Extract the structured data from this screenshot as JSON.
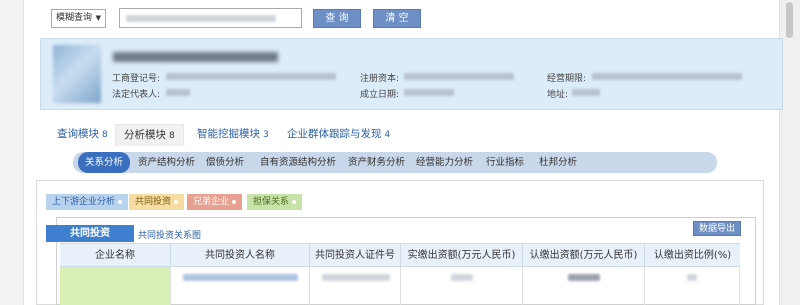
{
  "search": {
    "mode_label": "模糊查询",
    "query_button": "查 询",
    "clear_button": "清 空"
  },
  "company": {
    "fields": [
      {
        "label": "工商登记号:"
      },
      {
        "label": "注册资本:"
      },
      {
        "label": "经营期限:"
      },
      {
        "label": "法定代表人:"
      },
      {
        "label": "成立日期:"
      },
      {
        "label": "地址:"
      }
    ]
  },
  "main_tabs": [
    {
      "label": "查询模块",
      "count": "8"
    },
    {
      "label": "分析模块",
      "count": "8"
    },
    {
      "label": "智能挖掘模块",
      "count": "3"
    },
    {
      "label": "企业群体跟踪与发现",
      "count": "4"
    }
  ],
  "sub_tabs": [
    "关系分析",
    "资产结构分析",
    "偿债分析",
    "自有资源结构分析",
    "资产财务分析",
    "经营能力分析",
    "行业指标",
    "杜邦分析"
  ],
  "relation_tags": [
    {
      "label": "上下游企业分析",
      "color": "#b9d3ee"
    },
    {
      "label": "共同投资",
      "color": "#f6dca0"
    },
    {
      "label": "兄弟企业",
      "color": "#e8a191"
    },
    {
      "label": "担保关系",
      "color": "#c8e2a8"
    }
  ],
  "panel": {
    "active_tab": "共同投资",
    "link": "共同投资关系图",
    "export_button": "数据导出"
  },
  "table": {
    "columns": [
      "企业名称",
      "共同投资人名称",
      "共同投资人证件号",
      "实缴出资额(万元人民币)",
      "认缴出资额(万元人民币)",
      "认缴出资比例(%)"
    ]
  },
  "colors": {
    "accent": "#3a6fc0",
    "button": "#6d8fc5",
    "info_bg": "#dcecf8"
  }
}
